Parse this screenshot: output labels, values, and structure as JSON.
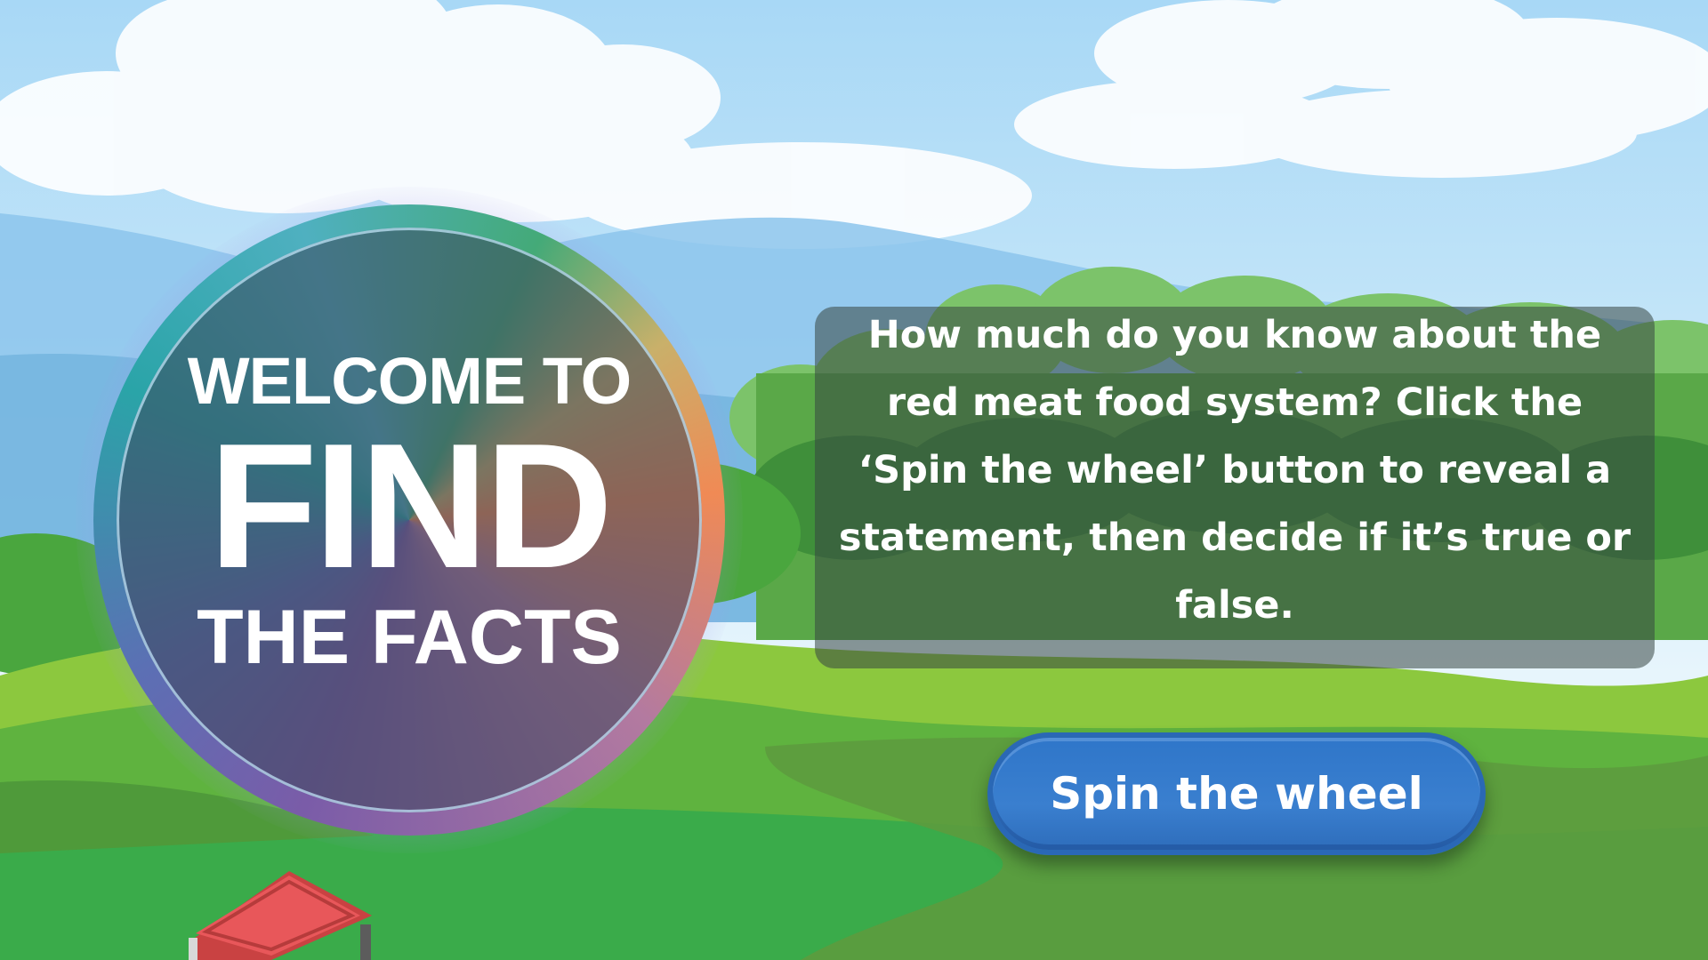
{
  "welcome_badge": {
    "line1": "WELCOME TO",
    "line2": "FIND",
    "line3": "THE FACTS"
  },
  "info_panel": {
    "text": "How much do you know about the red meat food system? Click the ‘Spin the wheel’ button to reveal a statement, then decide if it’s true or false."
  },
  "spin_button": {
    "label": "Spin the wheel"
  },
  "colors": {
    "sky": "#bfe3f8",
    "grass": "#3aab4a",
    "button": "#3a7fcf",
    "barn_roof": "#e8575a"
  }
}
